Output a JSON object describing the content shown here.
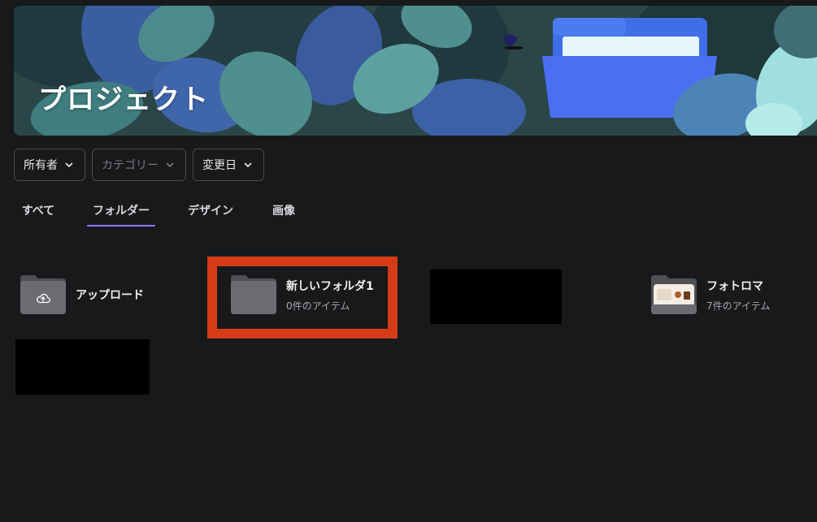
{
  "banner": {
    "title": "プロジェクト"
  },
  "filters": [
    {
      "label": "所有者",
      "disabled": false
    },
    {
      "label": "カテゴリー",
      "disabled": true
    },
    {
      "label": "変更日",
      "disabled": false
    }
  ],
  "tabs": [
    {
      "label": "すべて",
      "active": false
    },
    {
      "label": "フォルダー",
      "active": true
    },
    {
      "label": "デザイン",
      "active": false
    },
    {
      "label": "画像",
      "active": false
    }
  ],
  "items": {
    "upload": {
      "title": "アップロード",
      "icon": "cloud-upload-icon"
    },
    "new_folder": {
      "title": "新しいフォルダ1",
      "subtitle": "0件のアイテム",
      "icon": "folder-icon"
    },
    "photoroma": {
      "title": "フォトロマ",
      "subtitle": "7件のアイテム",
      "icon": "folder-icon"
    }
  },
  "colors": {
    "background": "#18191b",
    "accent_underline": "#8b7cf6",
    "highlight_border": "#d63b17",
    "redaction": "#000000"
  }
}
